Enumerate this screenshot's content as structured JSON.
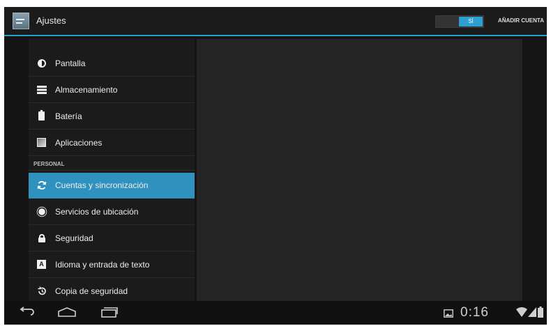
{
  "header": {
    "title": "Ajustes",
    "toggle_label": "SÍ",
    "add_account": "AÑADIR CUENTA"
  },
  "sidebar": {
    "section_personal": "PERSONAL",
    "items": [
      {
        "label": "Pantalla",
        "icon": "brightness-icon"
      },
      {
        "label": "Almacenamiento",
        "icon": "storage-icon"
      },
      {
        "label": "Batería",
        "icon": "battery-icon"
      },
      {
        "label": "Aplicaciones",
        "icon": "apps-icon"
      },
      {
        "label": "Cuentas y sincronización",
        "icon": "sync-icon",
        "selected": true
      },
      {
        "label": "Servicios de ubicación",
        "icon": "location-icon"
      },
      {
        "label": "Seguridad",
        "icon": "lock-icon"
      },
      {
        "label": "Idioma y entrada de texto",
        "icon": "language-icon"
      },
      {
        "label": "Copia de seguridad",
        "icon": "backup-icon"
      }
    ]
  },
  "status": {
    "clock": "0:16"
  },
  "colors": {
    "accent": "#2f92be",
    "background": "#141414"
  }
}
